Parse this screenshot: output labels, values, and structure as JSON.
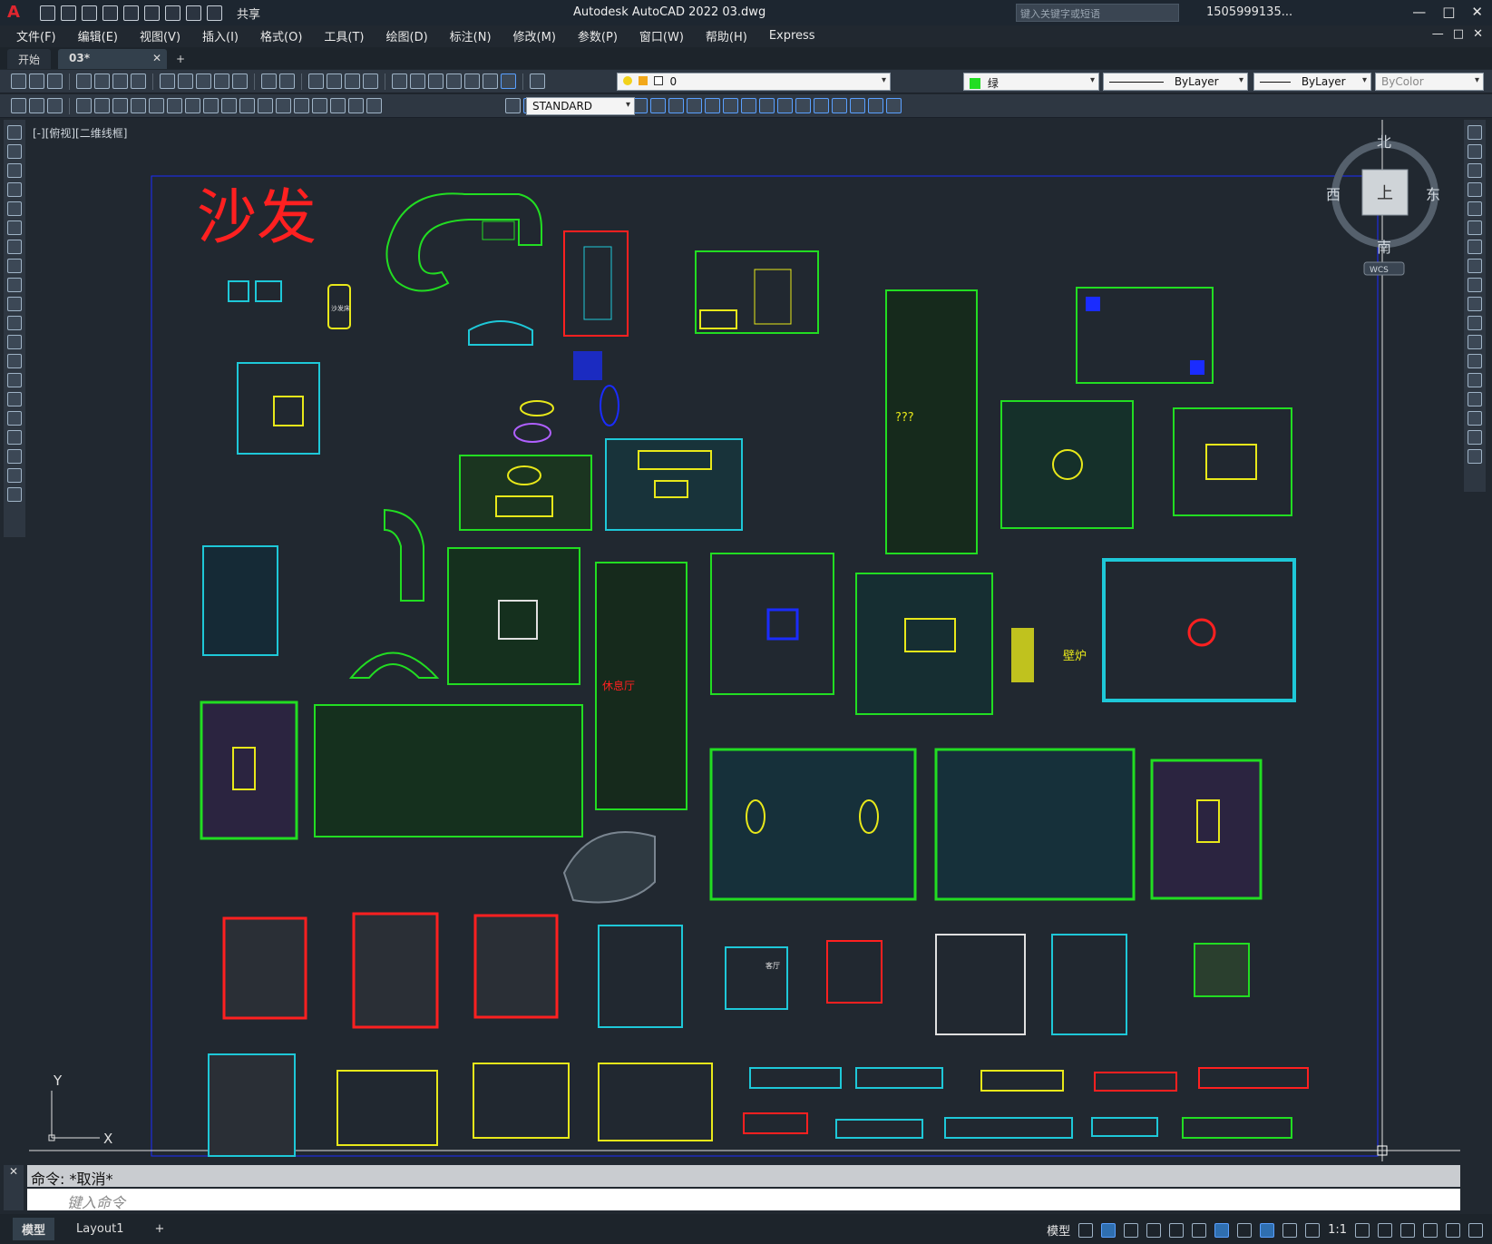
{
  "titlebar": {
    "logo": "A",
    "share_label": "共享",
    "title": "Autodesk AutoCAD 2022    03.dwg",
    "search_placeholder": "键入关键字或短语",
    "user": "1505999135...",
    "win_min": "—",
    "win_max": "□",
    "win_close": "✕"
  },
  "menubar": {
    "items": [
      "文件(F)",
      "编辑(E)",
      "视图(V)",
      "插入(I)",
      "格式(O)",
      "工具(T)",
      "绘图(D)",
      "标注(N)",
      "修改(M)",
      "参数(P)",
      "窗口(W)",
      "帮助(H)",
      "Express"
    ]
  },
  "tabs": {
    "start": "开始",
    "active": "03*",
    "close": "✕",
    "add": "+"
  },
  "toolbar1": {
    "layer_value": "0",
    "color_value": "绿",
    "linetype_value": "ByLayer",
    "lineweight_value": "ByLayer",
    "plotstyle_value": "ByColor"
  },
  "toolbar2": {
    "textstyle_value": "STANDARD"
  },
  "viewport": {
    "view_label": "[-][俯视][二维线框]",
    "title_text": "沙发",
    "label_fireplace": "壁炉",
    "label_restaurant": "休息厅",
    "label_qqq": "???",
    "label_sofa_small": "沙发床",
    "label_hall": "客厅",
    "viewcube": {
      "north": "北",
      "south": "南",
      "east": "东",
      "west": "西",
      "top": "上",
      "wcs": "WCS"
    },
    "ucs": {
      "x": "X",
      "y": "Y"
    }
  },
  "command": {
    "history": "命令: *取消*",
    "input_placeholder": "键入命令"
  },
  "statusbar": {
    "model_tab": "模型",
    "layout_tab": "Layout1",
    "add": "+",
    "model_label": "模型",
    "scale": "1:1"
  },
  "colors": {
    "cad_bg": "#212830",
    "red": "#ff2020",
    "green": "#22dd22",
    "yellow": "#e8e81a",
    "cyan": "#1ec8d8",
    "blue": "#1a2cff"
  }
}
